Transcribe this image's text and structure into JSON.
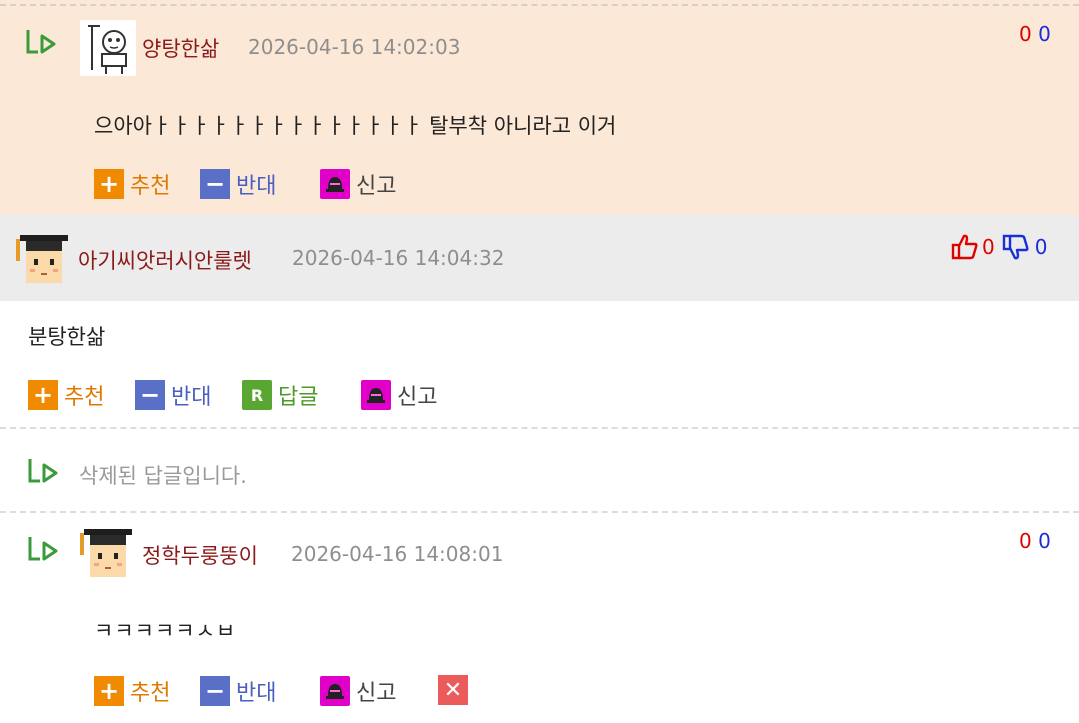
{
  "comments": [
    {
      "nickname": "양탕한삶",
      "date": "2026-04-16 14:02:03",
      "content": "으아아ㅏㅏㅏㅏㅏㅏㅏㅏㅏㅏㅏㅏㅏㅏ 탈부착 아니라고 이거",
      "votes_up": "0",
      "votes_down": "0"
    },
    {
      "nickname": "아기씨앗러시안룰렛",
      "date": "2026-04-16 14:04:32",
      "content": "분탕한삶",
      "votes_up": "0",
      "votes_down": "0"
    },
    {
      "deleted_text": "삭제된 답글입니다."
    },
    {
      "nickname": "정학두룽뚱이",
      "date": "2026-04-16 14:08:01",
      "content": "ㅋㅋㅋㅋㅋㅅㅂ",
      "votes_up": "0",
      "votes_down": "0"
    }
  ],
  "actions": {
    "recommend": "추천",
    "oppose": "반대",
    "reply": "답글",
    "report": "신고"
  },
  "icons": {
    "reply_badge": "R",
    "reply_arrow": "reply-arrow-icon",
    "thumb_up": "thumb-up-icon",
    "thumb_down": "thumb-down-icon",
    "siren": "siren-icon",
    "delete": "delete-icon"
  },
  "colors": {
    "highlight_bg": "#fce8d7",
    "header_bg": "#ececec",
    "nickname": "#8b1a1a",
    "recommend": "#f08a00",
    "oppose": "#5a70c6",
    "reply": "#5aa632",
    "report": "#e000c8",
    "delete": "#ec5b5b"
  }
}
